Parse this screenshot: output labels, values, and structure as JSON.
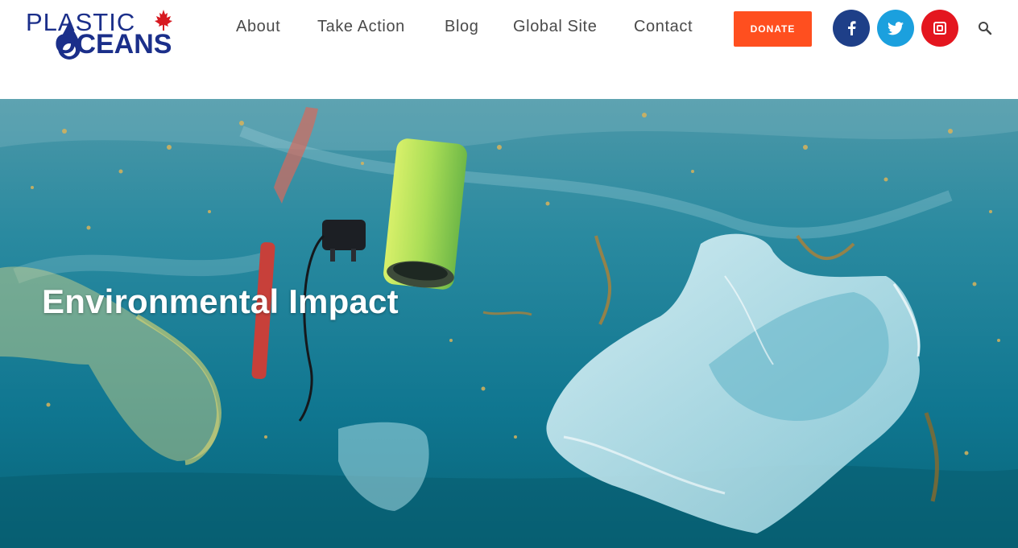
{
  "logo": {
    "line1": "PLASTIC",
    "line2": "OCEANS",
    "leaf_icon": "maple-leaf-icon",
    "drop_icon": "water-drop-icon",
    "brand_color": "#1b2f8a",
    "leaf_color": "#d71920"
  },
  "nav": {
    "items": [
      {
        "label": "About"
      },
      {
        "label": "Take Action"
      },
      {
        "label": "Blog"
      },
      {
        "label": "Global Site"
      },
      {
        "label": "Contact"
      }
    ]
  },
  "donate": {
    "label": "DONATE",
    "color": "#ff4f1f"
  },
  "social": [
    {
      "icon": "facebook-icon",
      "color": "#1e3f88"
    },
    {
      "icon": "twitter-icon",
      "color": "#1ba0de"
    },
    {
      "icon": "instagram-icon",
      "color": "#e4161f"
    }
  ],
  "search_icon": "search-icon",
  "hero": {
    "title": "Environmental Impact",
    "image_subject": "underwater-plastic-debris"
  }
}
